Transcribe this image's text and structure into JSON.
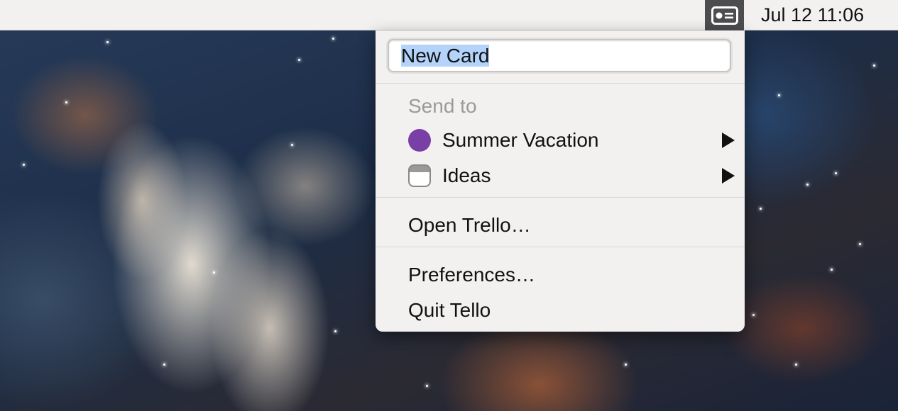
{
  "menubar": {
    "clock": "Jul 12 11:06",
    "status_icon": "trello-card-icon"
  },
  "menu": {
    "new_card_value": "New Card",
    "send_to_header": "Send to",
    "boards": [
      {
        "label": "Summer Vacation",
        "icon": "board-color-dot",
        "color": "#7a3fa6"
      },
      {
        "label": "Ideas",
        "icon": "board-default-icon",
        "color": "#9a9998"
      }
    ],
    "open_trello": "Open Trello…",
    "preferences": "Preferences…",
    "quit": "Quit Tello"
  },
  "colors": {
    "menubar_bg": "#f2f1f0",
    "status_item_bg": "#4d4d4f",
    "selection": "#b3d3fb"
  }
}
